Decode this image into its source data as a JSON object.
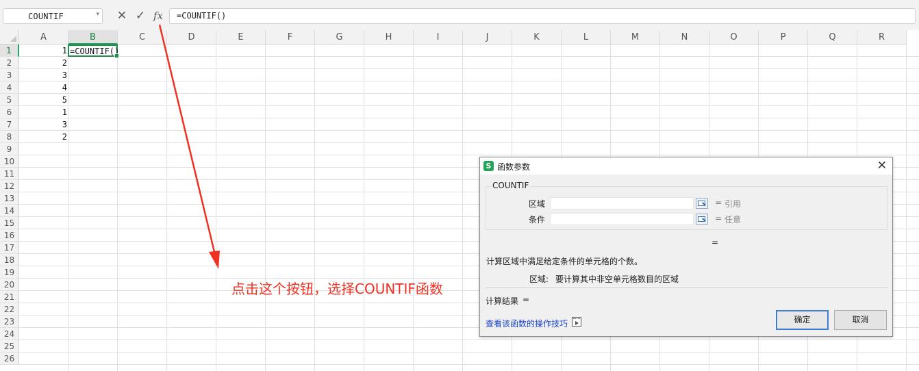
{
  "formula_bar": {
    "name_box": "COUNTIF",
    "cancel_icon": "✕",
    "enter_icon": "✓",
    "fx_label": "fx",
    "formula": "=COUNTIF()"
  },
  "sheet": {
    "columns": [
      "A",
      "B",
      "C",
      "D",
      "E",
      "F",
      "G",
      "H",
      "I",
      "J",
      "K",
      "L",
      "M",
      "N",
      "O",
      "P",
      "Q",
      "R"
    ],
    "selected_column": "B",
    "rows": [
      "1",
      "2",
      "3",
      "4",
      "5",
      "6",
      "7",
      "8",
      "9",
      "10",
      "11",
      "12",
      "13",
      "14",
      "15",
      "16",
      "17",
      "18",
      "19",
      "20",
      "21",
      "22",
      "23",
      "24",
      "25",
      "26"
    ],
    "selected_row": "1",
    "column_a_values": [
      "1",
      "2",
      "3",
      "4",
      "5",
      "1",
      "3",
      "2"
    ],
    "active_cell_text": "=COUNTIF()"
  },
  "annotation": {
    "text": "点击这个按钮，选择COUNTIF函数",
    "color": "#ef3124"
  },
  "dialog": {
    "title": "函数参数",
    "logo_glyph": "S",
    "close_icon": "✕",
    "function_name": "COUNTIF",
    "args": [
      {
        "label": "区域",
        "eq": "=",
        "type": "引用"
      },
      {
        "label": "条件",
        "eq": "=",
        "type": "任意"
      }
    ],
    "result_eq": "=",
    "description": "计算区域中满足给定条件的单元格的个数。",
    "arg_desc_name": "区域:",
    "arg_desc_text": "要计算其中非空单元格数目的区域",
    "calc_result_label": "计算结果",
    "calc_result_eq": "=",
    "help_link": "查看该函数的操作技巧",
    "ok_label": "确定",
    "cancel_label": "取消"
  },
  "colors": {
    "selection_green": "#1e8e4c",
    "dialog_button_focus": "#3c7fd0",
    "link_blue": "#1a44c8"
  }
}
